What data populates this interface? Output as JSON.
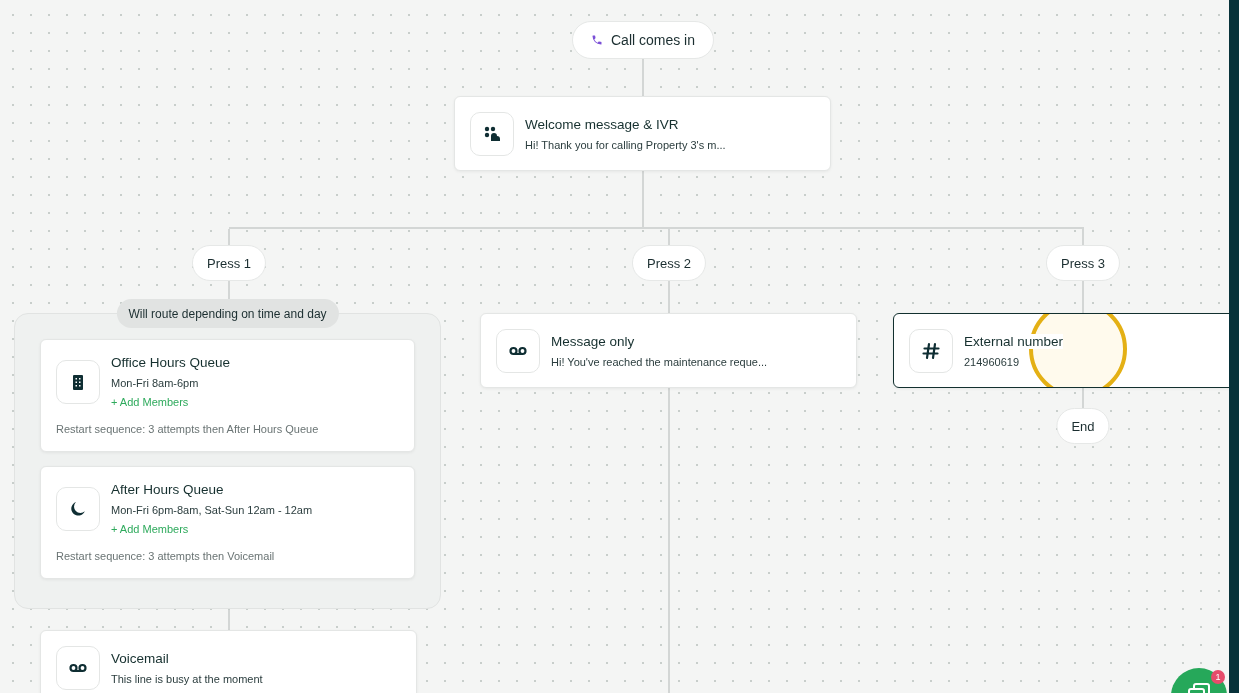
{
  "start": {
    "label": "Call comes in"
  },
  "welcome": {
    "kind": "ivr",
    "title": "Welcome message & IVR",
    "subtitle": "Hi! Thank you for calling Property 3's m...",
    "selected": false
  },
  "branches": [
    {
      "label": "Press 1",
      "group": {
        "label": "Will route depending on time and day",
        "queues": [
          {
            "kind": "office",
            "title": "Office Hours Queue",
            "subtitle": "Mon-Fri 8am-6pm",
            "action": "+ Add Members",
            "note": "Restart sequence: 3 attempts then After Hours Queue",
            "selected": false
          },
          {
            "kind": "night",
            "title": "After Hours Queue",
            "subtitle": "Mon-Fri 6pm-8am, Sat-Sun 12am - 12am",
            "action": "+ Add Members",
            "note": "Restart sequence: 3 attempts then Voicemail",
            "selected": false
          }
        ]
      },
      "next": {
        "kind": "voicemail",
        "title": "Voicemail",
        "subtitle": "This line is busy at the moment",
        "selected": false
      }
    },
    {
      "label": "Press 2",
      "node": {
        "kind": "voicemail",
        "title": "Message only",
        "subtitle": "Hi! You've reached the maintenance reque...",
        "selected": false
      }
    },
    {
      "label": "Press 3",
      "node": {
        "kind": "number",
        "title": "External number",
        "subtitle": "214960619",
        "selected": true
      },
      "end": "End"
    }
  ],
  "chat": {
    "badge": "1"
  }
}
